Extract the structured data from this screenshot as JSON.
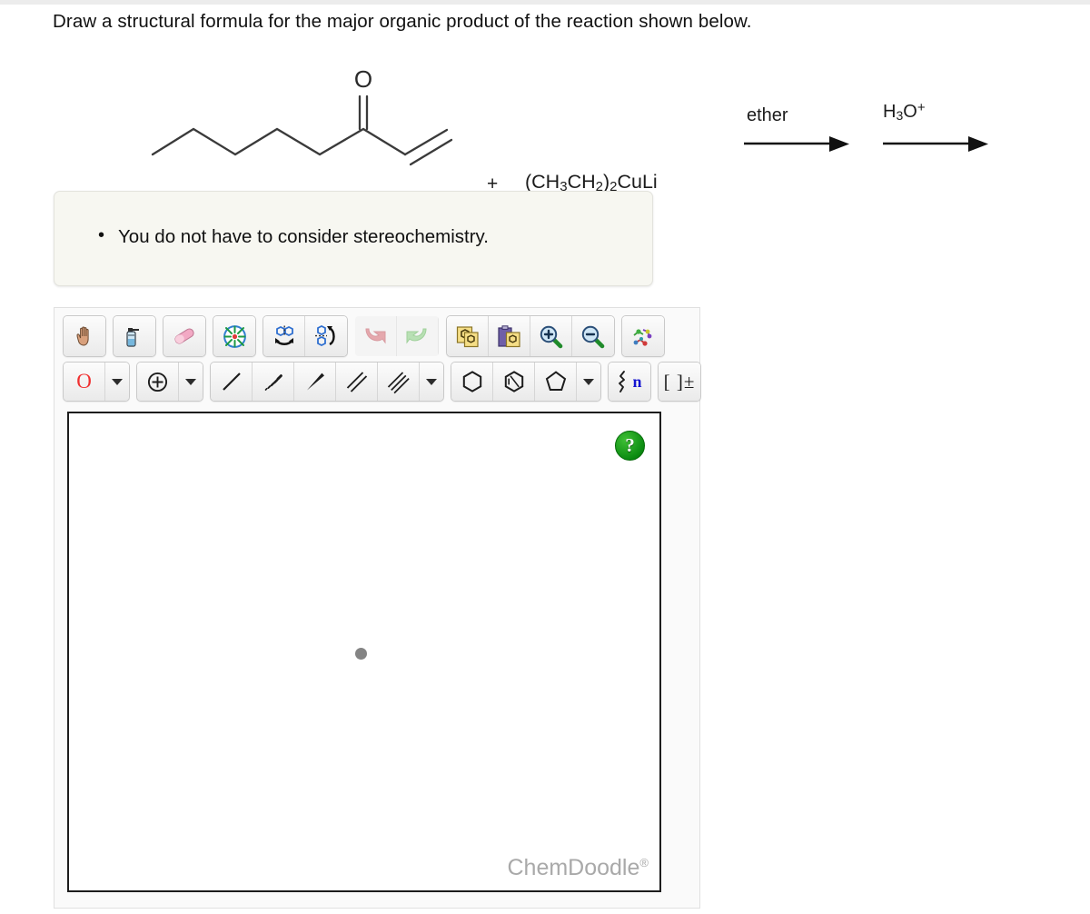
{
  "question": {
    "text": "Draw a structural formula for the major organic product of the reaction shown below."
  },
  "reaction": {
    "substrate_name": "oct-1-en-3-one skeletal structure",
    "carbonyl_oxygen_label": "O",
    "plus": "+",
    "reagent": "(CH3CH2)2CuLi",
    "reagent_parts": {
      "open_paren": "(CH",
      "sub_3": "3",
      "ch": "CH",
      "sub_2a": "2",
      "close_paren": ")",
      "sub_2b": "2",
      "metal": "CuLi"
    },
    "conditions": [
      {
        "label": "ether",
        "sub": "",
        "sup": ""
      },
      {
        "label": "H",
        "sub": "3",
        "tail": "O",
        "sup": "+"
      }
    ]
  },
  "note": {
    "items": [
      "You do not have to consider stereochemistry."
    ]
  },
  "sketcher": {
    "toolbar_row1": [
      {
        "name": "pan-hand-tool",
        "icon": "hand-icon",
        "label": "Pan"
      },
      {
        "name": "lasso-select-tool",
        "icon": "spray-bottle-icon",
        "label": "Erase/Clear"
      },
      {
        "name": "eraser-tool",
        "icon": "eraser-icon",
        "label": "Eraser"
      },
      {
        "name": "optimize-layout-tool",
        "icon": "clean-structure-icon",
        "label": "Clean Structure"
      },
      {
        "name": "flip-horizontal-tool",
        "icon": "flip-horizontal-icon",
        "label": "Flip Horizontal"
      },
      {
        "name": "flip-vertical-tool",
        "icon": "flip-vertical-icon",
        "label": "Flip Vertical"
      },
      {
        "name": "undo-button",
        "icon": "undo-arrow-icon",
        "label": "Undo"
      },
      {
        "name": "redo-button",
        "icon": "redo-arrow-icon",
        "label": "Redo"
      },
      {
        "name": "copy-button",
        "icon": "copy-icon",
        "label": "Copy"
      },
      {
        "name": "paste-button",
        "icon": "paste-icon",
        "label": "Paste"
      },
      {
        "name": "zoom-in-button",
        "icon": "magnifier-plus-icon",
        "label": "Zoom In"
      },
      {
        "name": "zoom-out-button",
        "icon": "magnifier-minus-icon",
        "label": "Zoom Out"
      },
      {
        "name": "templates-button",
        "icon": "molecule-templates-icon",
        "label": "Templates"
      }
    ],
    "toolbar_row2": {
      "atom_label": "O",
      "atom_dropdown": "▼",
      "charge_tool": "⊕",
      "charge_dropdown": "▼",
      "bonds": [
        {
          "name": "single-bond-tool",
          "icon": "single-bond-icon"
        },
        {
          "name": "hashed-wedge-bond-tool",
          "icon": "hashed-wedge-icon"
        },
        {
          "name": "solid-wedge-bond-tool",
          "icon": "solid-wedge-icon"
        },
        {
          "name": "double-bond-tool",
          "icon": "double-bond-icon"
        },
        {
          "name": "triple-bond-tool",
          "icon": "triple-bond-icon"
        }
      ],
      "bond_dropdown": "▼",
      "rings": [
        {
          "name": "cyclohexane-ring-tool",
          "icon": "hexagon-icon"
        },
        {
          "name": "benzene-ring-tool",
          "icon": "aromatic-hexagon-icon"
        },
        {
          "name": "cyclopentane-ring-tool",
          "icon": "pentagon-icon"
        }
      ],
      "ring_dropdown": "▼",
      "repeat_unit": "n",
      "bracket_charge": "[ ]±"
    },
    "canvas": {
      "help_label": "?",
      "watermark": "ChemDoodle",
      "watermark_mark": "®"
    }
  }
}
